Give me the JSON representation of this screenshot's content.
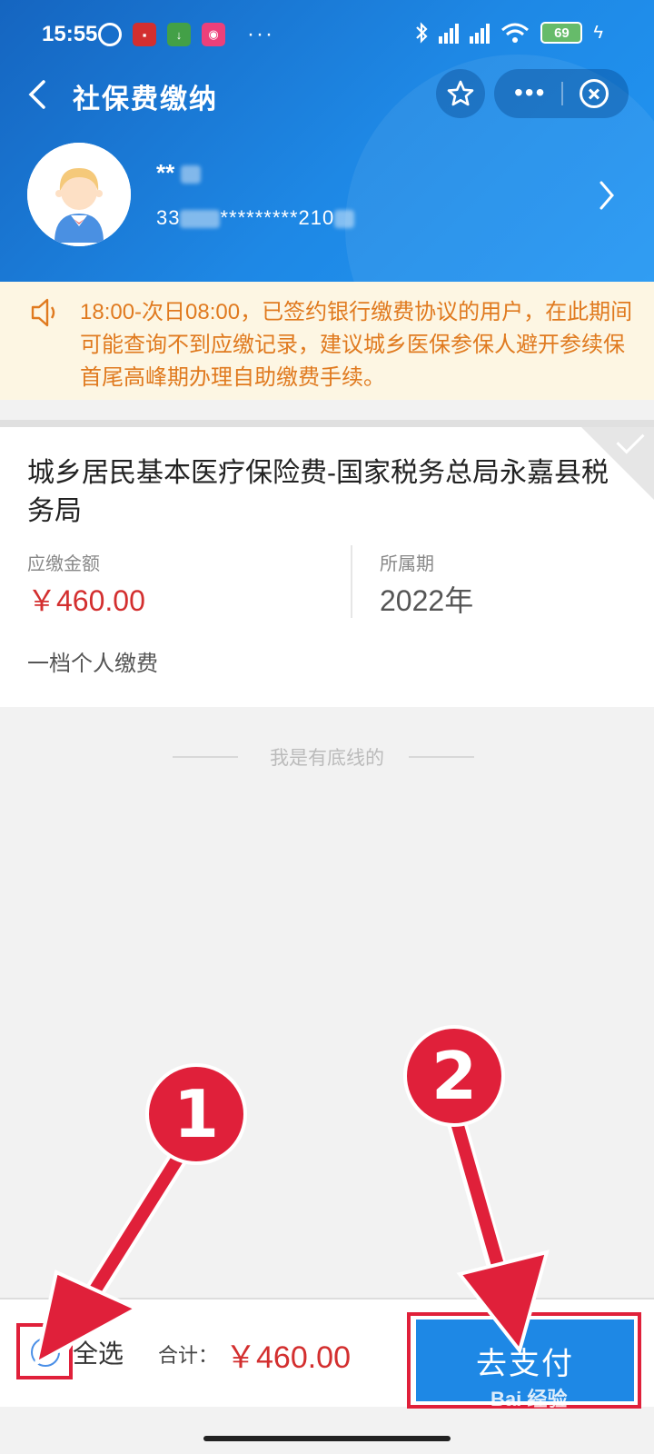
{
  "status_bar": {
    "time": "15:55",
    "battery": "69",
    "dots": "···"
  },
  "header": {
    "title": "社保费缴纳",
    "more": "•••"
  },
  "user": {
    "name_prefix": "**",
    "id_prefix": "33",
    "id_middle": "*********210"
  },
  "notice": {
    "text": "18:00-次日08:00，已签约银行缴费协议的用户，在此期间可能查询不到应缴记录，建议城乡医保参保人避开参续保首尾高峰期办理自助缴费手续。"
  },
  "card": {
    "title": "城乡居民基本医疗保险费-国家税务总局永嘉县税务局",
    "amount_label": "应缴金额",
    "amount_value": "￥460.00",
    "period_label": "所属期",
    "period_value": "2022年",
    "tier": "一档个人缴费"
  },
  "bottom_line": "我是有底线的",
  "footer": {
    "select_all": "全选",
    "total_label": "合计：",
    "total_value": "￥460.00",
    "pay_button": "去支付"
  },
  "annotations": {
    "badge_1": "1",
    "badge_2": "2",
    "watermark": "Bai 经验"
  },
  "colors": {
    "brand_blue": "#1e88e5",
    "alert_red": "#d32f2f",
    "notice_orange": "#e07a1f",
    "annotation_red": "#e0203a"
  }
}
